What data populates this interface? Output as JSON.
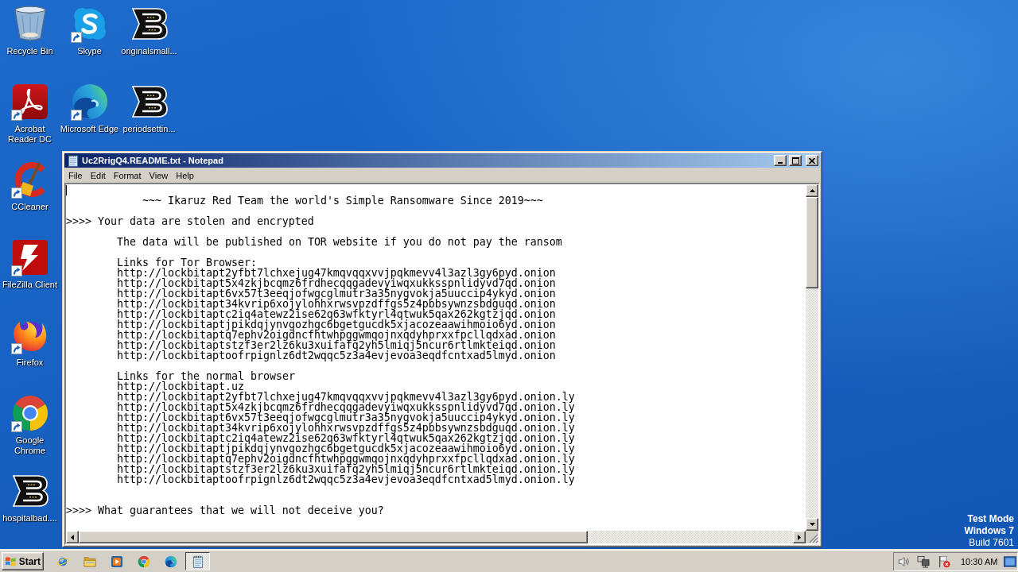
{
  "desktop": {
    "columns": [
      {
        "icons": [
          {
            "label": "Recycle Bin",
            "kind": "bin",
            "shortcut": false
          },
          {
            "label": "Acrobat Reader DC",
            "kind": "acrobat",
            "shortcut": true
          },
          {
            "label": "CCleaner",
            "kind": "ccleaner",
            "shortcut": true
          },
          {
            "label": "FileZilla Client",
            "kind": "filezilla",
            "shortcut": true
          },
          {
            "label": "Firefox",
            "kind": "firefox",
            "shortcut": true
          },
          {
            "label": "Google Chrome",
            "kind": "chrome",
            "shortcut": true
          },
          {
            "label": "hospitalbad....",
            "kind": "logo",
            "shortcut": false
          }
        ]
      },
      {
        "icons": [
          {
            "label": "Skype",
            "kind": "skype",
            "shortcut": true
          },
          {
            "label": "Microsoft Edge",
            "kind": "edge",
            "shortcut": true
          }
        ]
      },
      {
        "icons": [
          {
            "label": "originalsmall...",
            "kind": "logo",
            "shortcut": false
          },
          {
            "label": "periodsettin...",
            "kind": "logo",
            "shortcut": false
          }
        ]
      }
    ]
  },
  "notepad": {
    "title": "Uc2RrigQ4.README.txt - Notepad",
    "active": true,
    "menu": [
      "File",
      "Edit",
      "Format",
      "View",
      "Help"
    ],
    "text_area": {
      "focused": true,
      "banner": "~~~ Ikaruz Red Team the world's Simple Ransomware Since 2019~~~",
      "sections": [
        {
          "heading": ">>>> Your data are stolen and encrypted",
          "children": [
            {
              "lines": [
                "The data will be published on TOR website if you do not pay the ransom"
              ]
            },
            {
              "lines": [
                "Links for Tor Browser:",
                "http://lockbitapt2yfbt7lchxejug47kmqvqqxvvjpqkmevv4l3azl3gy6pyd.onion",
                "http://lockbitapt5x4zkjbcqmz6frdhecqqgadevyiwqxukksspnlidyvd7qd.onion",
                "http://lockbitapt6vx57t3eeqjofwgcglmutr3a35nygvokja5uuccip4ykyd.onion",
                "http://lockbitapt34kvrip6xojylohhxrwsvpzdffgs5z4pbbsywnzsbdguqd.onion",
                "http://lockbitaptc2iq4atewz2ise62q63wfktyrl4qtwuk5qax262kgtzjqd.onion",
                "http://lockbitaptjpikdqjynvgozhgc6bgetgucdk5xjacozeaawihmoio6yd.onion",
                "http://lockbitaptq7ephv2oigdncfhtwhpggwmqojnxqdyhprxxfpcllqdxad.onion",
                "http://lockbitaptstzf3er2lz6ku3xuifafq2yh5lmiqj5ncur6rtlmkteiqd.onion",
                "http://lockbitaptoofrpignlz6dt2wqqc5z3a4evjevoa3eqdfcntxad5lmyd.onion"
              ]
            },
            {
              "lines": [
                "Links for the normal browser",
                "http://lockbitapt.uz",
                "http://lockbitapt2yfbt7lchxejug47kmqvqqxvvjpqkmevv4l3azl3gy6pyd.onion.ly",
                "http://lockbitapt5x4zkjbcqmz6frdhecqqgadevyiwqxukksspnlidyvd7qd.onion.ly",
                "http://lockbitapt6vx57t3eeqjofwgcglmutr3a35nygvokja5uuccip4ykyd.onion.ly",
                "http://lockbitapt34kvrip6xojylohhxrwsvpzdffgs5z4pbbsywnzsbdguqd.onion.ly",
                "http://lockbitaptc2iq4atewz2ise62q63wfktyrl4qtwuk5qax262kgtzjqd.onion.ly",
                "http://lockbitaptjpikdqjynvgozhgc6bgetgucdk5xjacozeaawihmoio6yd.onion.ly",
                "http://lockbitaptq7ephv2oigdncfhtwhpggwmqojnxqdyhprxxfpcllqdxad.onion.ly",
                "http://lockbitaptstzf3er2lz6ku3xuifafq2yh5lmiqj5ncur6rtlmkteiqd.onion.ly",
                "http://lockbitaptoofrpignlz6dt2wqqc5z3a4evjevoa3eqdfcntxad5lmyd.onion.ly"
              ]
            }
          ]
        },
        {
          "heading": ">>>> What guarantees that we will not deceive you?"
        }
      ]
    }
  },
  "system_info": [
    {
      "text": "Test Mode",
      "bold": true
    },
    {
      "text": "Windows 7",
      "bold": true
    },
    {
      "text": "Build 7601",
      "bold": false
    }
  ],
  "taskbar": {
    "start": "Start",
    "quick_launch": [
      {
        "kind": "ie"
      },
      {
        "kind": "folder"
      },
      {
        "kind": "media"
      },
      {
        "kind": "chrome"
      },
      {
        "kind": "edge"
      }
    ],
    "tasks": [
      {
        "kind": "notepad",
        "selected": true
      }
    ],
    "tray": {
      "icons": [
        {
          "kind": "speaker"
        },
        {
          "kind": "network"
        },
        {
          "kind": "flag"
        }
      ],
      "clock": "10:30 AM"
    }
  }
}
